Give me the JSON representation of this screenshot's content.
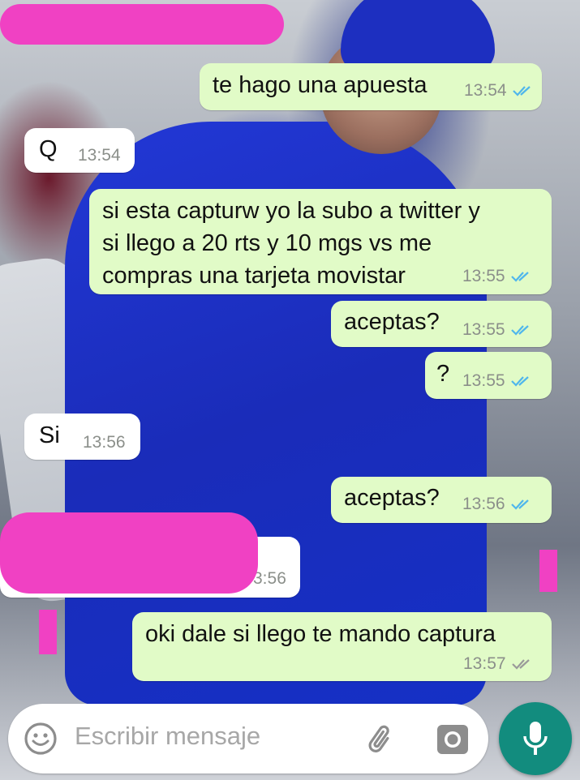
{
  "messages": [
    {
      "dir": "out",
      "text": "te hago una apuesta",
      "time": "13:54",
      "status": "read"
    },
    {
      "dir": "in",
      "text": "Q",
      "time": "13:54"
    },
    {
      "dir": "out",
      "text": "si esta capturw yo la subo a twitter y\nsi llego a 20 rts y 10 mgs vs me\ncompras una tarjeta movistar",
      "time": "13:55",
      "status": "read"
    },
    {
      "dir": "out",
      "text": "aceptas?",
      "time": "13:55",
      "status": "read"
    },
    {
      "dir": "out",
      "text": "?",
      "time": "13:55",
      "status": "read"
    },
    {
      "dir": "in",
      "text": "Si",
      "time": "13:56"
    },
    {
      "dir": "out",
      "text": "aceptas?",
      "time": "13:56",
      "status": "read"
    },
    {
      "dir": "in",
      "text": "",
      "time": "3:56",
      "redacted": true
    },
    {
      "dir": "out",
      "text": "oki dale si llego te mando captura",
      "time": "13:57",
      "status": "delivered"
    }
  ],
  "composer": {
    "placeholder": "Escribir mensaje",
    "emoji_icon": "emoji-icon",
    "attach_icon": "paperclip-icon",
    "camera_icon": "camera-icon",
    "mic_icon": "microphone-icon"
  },
  "colors": {
    "outgoing_bubble": "#e1fbc7",
    "incoming_bubble": "#ffffff",
    "read_tick": "#4fb6ec",
    "delivered_tick": "#9a9a9a",
    "mic_button": "#128c7e",
    "redaction": "#f041c3"
  }
}
